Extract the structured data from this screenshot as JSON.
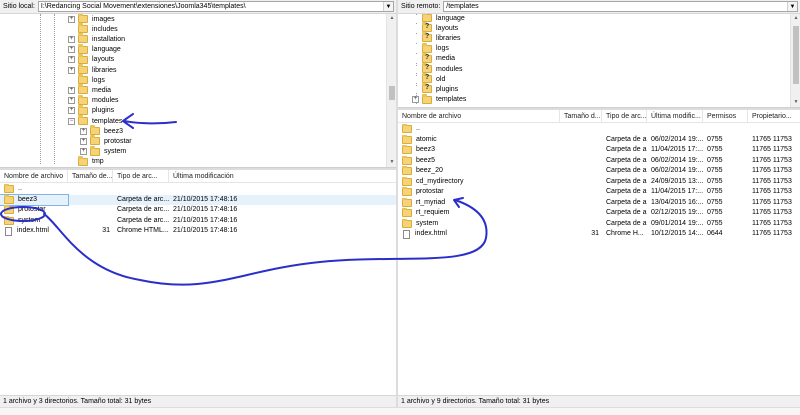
{
  "local": {
    "path_label": "Sitio local:",
    "path_value": "I:\\Redancing Social Movement\\extensiones\\Joomla345\\templates\\",
    "tree": [
      {
        "label": "images",
        "expander": "+"
      },
      {
        "label": "includes",
        "expander": ""
      },
      {
        "label": "installation",
        "expander": "+"
      },
      {
        "label": "language",
        "expander": "+"
      },
      {
        "label": "layouts",
        "expander": "+"
      },
      {
        "label": "libraries",
        "expander": "+"
      },
      {
        "label": "logs",
        "expander": ""
      },
      {
        "label": "media",
        "expander": "+"
      },
      {
        "label": "modules",
        "expander": "+"
      },
      {
        "label": "plugins",
        "expander": "+"
      },
      {
        "label": "templates",
        "expander": "−"
      },
      {
        "label": "beez3",
        "expander": "+"
      },
      {
        "label": "protostar",
        "expander": "+"
      },
      {
        "label": "system",
        "expander": "+"
      },
      {
        "label": "tmp",
        "expander": ""
      }
    ],
    "columns": [
      "Nombre de archivo",
      "Tamaño de...",
      "Tipo de arc...",
      "Última modificación"
    ],
    "files": [
      {
        "name": "..",
        "size": "",
        "type": "",
        "modified": "",
        "icon": "folder"
      },
      {
        "name": "beez3",
        "size": "",
        "type": "Carpeta de arc...",
        "modified": "21/10/2015 17:48:16",
        "icon": "folder"
      },
      {
        "name": "protostar",
        "size": "",
        "type": "Carpeta de arc...",
        "modified": "21/10/2015 17:48:16",
        "icon": "folder"
      },
      {
        "name": "system",
        "size": "",
        "type": "Carpeta de arc...",
        "modified": "21/10/2015 17:48:16",
        "icon": "folder"
      },
      {
        "name": "index.html",
        "size": "31",
        "type": "Chrome HTML...",
        "modified": "21/10/2015 17:48:16",
        "icon": "file"
      }
    ],
    "status": "1 archivo y 3 directorios. Tamaño total: 31 bytes"
  },
  "remote": {
    "path_label": "Sitio remoto:",
    "path_value": "/templates",
    "tree": [
      {
        "label": "language",
        "icon": "folder"
      },
      {
        "label": "layouts",
        "icon": "q"
      },
      {
        "label": "libraries",
        "icon": "q"
      },
      {
        "label": "logs",
        "icon": "folder"
      },
      {
        "label": "media",
        "icon": "q"
      },
      {
        "label": "modules",
        "icon": "q"
      },
      {
        "label": "old",
        "icon": "q"
      },
      {
        "label": "plugins",
        "icon": "q"
      },
      {
        "label": "templates",
        "icon": "folder"
      }
    ],
    "columns": [
      "Nombre de archivo",
      "Tamaño d...",
      "Tipo de arc...",
      "Última modific...",
      "Permisos",
      "Propietario..."
    ],
    "files": [
      {
        "name": "..",
        "size": "",
        "type": "",
        "modified": "",
        "perms": "",
        "owner": "",
        "icon": "folder"
      },
      {
        "name": "atomic",
        "size": "",
        "type": "Carpeta de ar...",
        "modified": "06/02/2014 19:...",
        "perms": "0755",
        "owner": "11765 11753",
        "icon": "folder"
      },
      {
        "name": "beez3",
        "size": "",
        "type": "Carpeta de ar...",
        "modified": "11/04/2015 17:...",
        "perms": "0755",
        "owner": "11765 11753",
        "icon": "folder"
      },
      {
        "name": "beez5",
        "size": "",
        "type": "Carpeta de ar...",
        "modified": "06/02/2014 19:...",
        "perms": "0755",
        "owner": "11765 11753",
        "icon": "folder"
      },
      {
        "name": "beez_20",
        "size": "",
        "type": "Carpeta de ar...",
        "modified": "06/02/2014 19:...",
        "perms": "0755",
        "owner": "11765 11753",
        "icon": "folder"
      },
      {
        "name": "cd_mydirectory",
        "size": "",
        "type": "Carpeta de ar...",
        "modified": "24/09/2015 13:...",
        "perms": "0755",
        "owner": "11765 11753",
        "icon": "folder"
      },
      {
        "name": "protostar",
        "size": "",
        "type": "Carpeta de ar...",
        "modified": "11/04/2015 17:...",
        "perms": "0755",
        "owner": "11765 11753",
        "icon": "folder"
      },
      {
        "name": "rt_myriad",
        "size": "",
        "type": "Carpeta de ar...",
        "modified": "13/04/2015 16:...",
        "perms": "0755",
        "owner": "11765 11753",
        "icon": "folder"
      },
      {
        "name": "rt_requiem",
        "size": "",
        "type": "Carpeta de ar...",
        "modified": "02/12/2015 19:...",
        "perms": "0755",
        "owner": "11765 11753",
        "icon": "folder"
      },
      {
        "name": "system",
        "size": "",
        "type": "Carpeta de ar...",
        "modified": "09/01/2014 19:...",
        "perms": "0755",
        "owner": "11765 11753",
        "icon": "folder"
      },
      {
        "name": "index.html",
        "size": "31",
        "type": "Chrome H...",
        "modified": "10/12/2015 14:...",
        "perms": "0644",
        "owner": "11765 11753",
        "icon": "file"
      }
    ],
    "status": "1 archivo y 9 directorios. Tamaño total: 31 bytes"
  },
  "colors": {
    "annotation": "#2b2fc9",
    "folder": "#f5d376",
    "selection": "#e5f1fb"
  }
}
